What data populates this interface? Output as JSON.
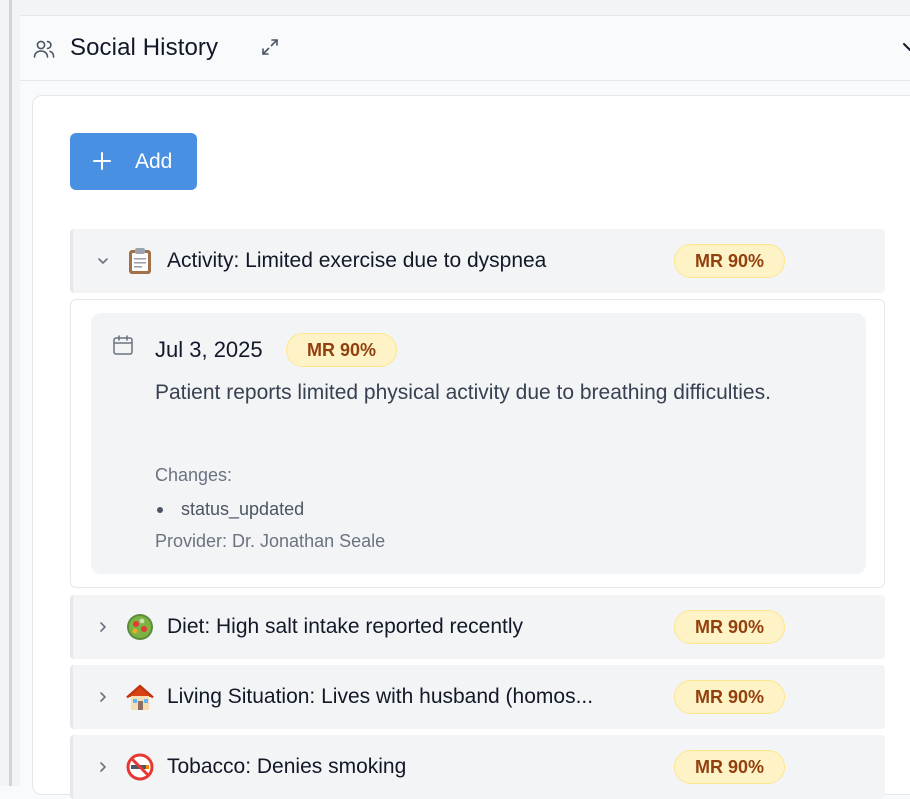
{
  "section": {
    "title": "Social History"
  },
  "add_button": {
    "label": "Add"
  },
  "entries": [
    {
      "label": "Activity: Limited exercise due to dyspnea",
      "badge": "MR 90%",
      "icon": "clipboard-icon",
      "expanded": true
    },
    {
      "label": "Diet: High salt intake reported recently",
      "badge": "MR 90%",
      "icon": "salad-icon",
      "expanded": false
    },
    {
      "label": "Living Situation: Lives with husband (homos...",
      "badge": "MR 90%",
      "icon": "house-icon",
      "expanded": false
    },
    {
      "label": "Tobacco: Denies smoking",
      "badge": "MR 90%",
      "icon": "no-smoking-icon",
      "expanded": false
    }
  ],
  "detail": {
    "date": "Jul 3, 2025",
    "badge": "MR 90%",
    "description": "Patient reports limited physical activity due to breathing difficulties.",
    "changes_label": "Changes:",
    "changes": [
      "status_updated"
    ],
    "provider": "Provider: Dr. Jonathan Seale"
  },
  "colors": {
    "accent": "#4a90e2",
    "badge_bg": "#fef3c7",
    "badge_text": "#92400e"
  }
}
